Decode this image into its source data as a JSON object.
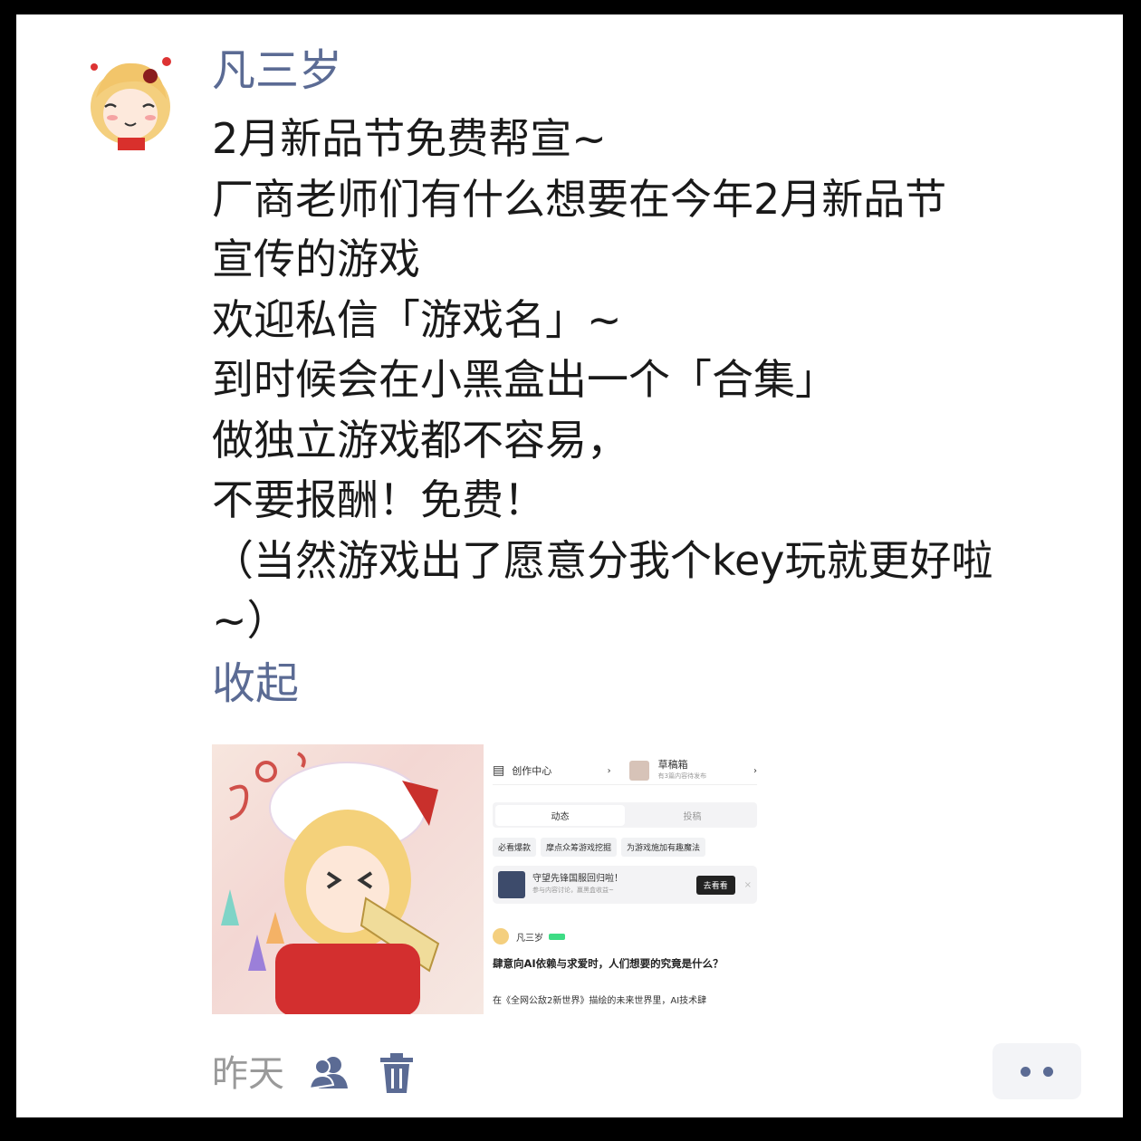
{
  "author": {
    "name": "凡三岁"
  },
  "post": {
    "lines": [
      "2月新品节免费帮宣~",
      "厂商老师们有什么想要在今年2月新品节",
      "宣传的游戏",
      "欢迎私信「游戏名」~",
      "到时候会在小黑盒出一个「合集」",
      "做独立游戏都不容易，",
      "不要报酬！免费！",
      "（当然游戏出了愿意分我个key玩就更好啦",
      "~）"
    ],
    "collapse_label": "收起"
  },
  "media": {
    "screenshot": {
      "creator_center": "创作中心",
      "drafts_title": "草稿箱",
      "drafts_sub": "有3篇内容待发布",
      "tab_dynamic": "动态",
      "tab_submit": "投稿",
      "chips": [
        "必看爆款",
        "摩点众筹游戏挖掘",
        "为游戏施加有趣魔法"
      ],
      "promo_title": "守望先锋国服回归啦！",
      "promo_sub": "参与内容讨论，赢黑盒收益~",
      "promo_button": "去看看",
      "post_author": "凡三岁",
      "post_title": "肆意向AI依赖与求爱时，人们想要的究竟是什么？",
      "post_excerpt": "在《全网公敌2新世界》描绘的未来世界里，AI技术肆"
    }
  },
  "footer": {
    "time": "昨天",
    "icons": [
      "friends-visibility-icon",
      "trash-icon",
      "more-icon"
    ]
  },
  "colors": {
    "link": "#5b6b94",
    "text": "#1a1a1a",
    "muted": "#9a9a9a",
    "background": "#000000",
    "card": "#ffffff"
  }
}
